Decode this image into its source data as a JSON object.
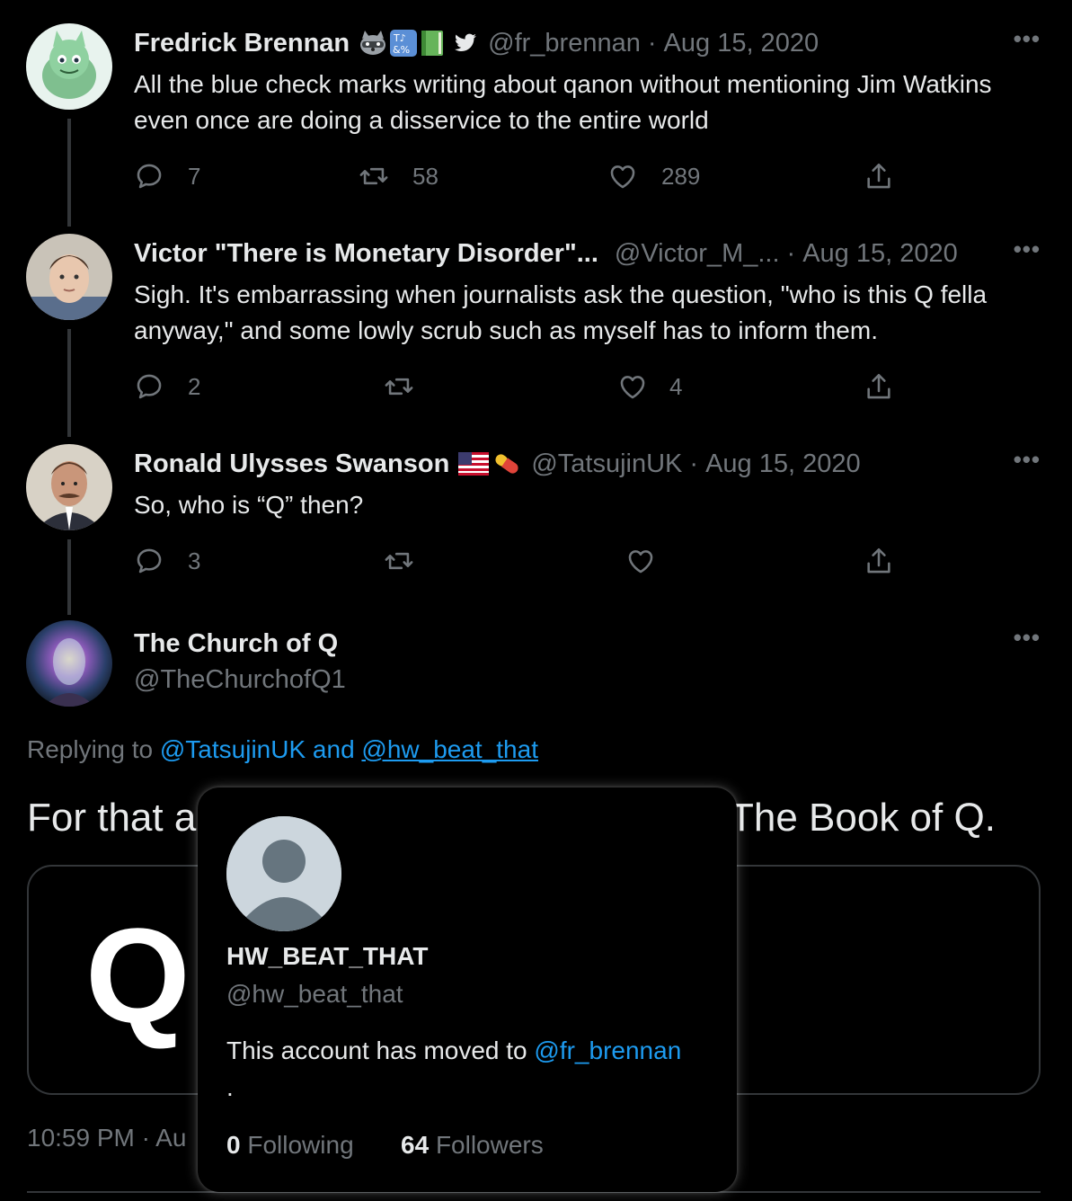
{
  "tweets": [
    {
      "name": "Fredrick Brennan",
      "handle": "@fr_brennan",
      "date": "Aug 15, 2020",
      "text": "All the blue check marks writing about qanon without mentioning Jim Watkins even once are doing a disservice to the entire world",
      "replies": "7",
      "retweets": "58",
      "likes": "289"
    },
    {
      "name": "Victor \"There is Monetary Disorder\"...",
      "handle": "@Victor_M_...",
      "date": "Aug 15, 2020",
      "text": "Sigh. It's embarrassing when journalists ask the question, \"who is this Q fella anyway,\" and some lowly scrub such as myself has to inform them.",
      "replies": "2",
      "retweets": "",
      "likes": "4"
    },
    {
      "name": "Ronald Ulysses Swanson",
      "handle": "@TatsujinUK",
      "date": "Aug 15, 2020",
      "text": "So, who is “Q” then?",
      "replies": "3",
      "retweets": "",
      "likes": ""
    }
  ],
  "main": {
    "name": "The Church of Q",
    "handle": "@TheChurchofQ1",
    "replying_prefix": "Replying to",
    "reply_user1": "@TatsujinUK",
    "reply_and": "and",
    "reply_user2": "@hw_beat_that",
    "text_left": "For that a",
    "text_right": "The Book of Q.",
    "card_letter": "Q",
    "timestamp": "10:59 PM · Au"
  },
  "hovercard": {
    "name": "HW_BEAT_THAT",
    "handle": "@hw_beat_that",
    "bio_prefix": "This account has moved to",
    "bio_link": "@fr_brennan",
    "bio_suffix": ".",
    "following_count": "0",
    "following_label": "Following",
    "followers_count": "64",
    "followers_label": "Followers"
  },
  "dot": "·",
  "more": "•••",
  "colors": {
    "background": "#000000",
    "text": "#e7e9ea",
    "muted": "#71767b",
    "link": "#1d9bf0",
    "border": "#333639"
  },
  "icons": [
    "reply-icon",
    "retweet-icon",
    "like-icon",
    "share-icon",
    "twitter-bird-icon",
    "raccoon-emoji-icon",
    "symbols-emoji-icon",
    "green-book-emoji-icon",
    "us-flag-emoji-icon",
    "pill-emoji-icon"
  ]
}
